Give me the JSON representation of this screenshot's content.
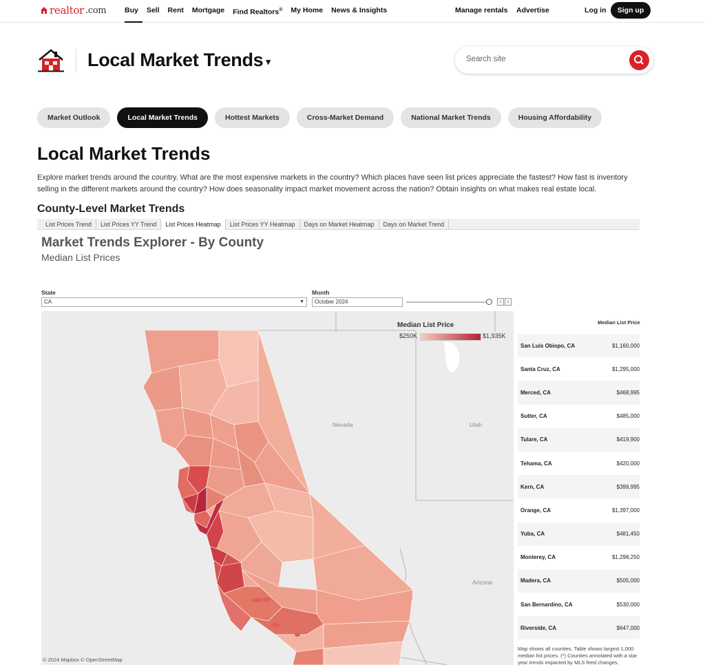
{
  "nav": {
    "logo": "realtor",
    "logo_suffix": ".com",
    "links": [
      "Buy",
      "Sell",
      "Rent",
      "Mortgage",
      "Find Realtors",
      "My Home",
      "News & Insights"
    ],
    "find_realtors_mark": "®",
    "manage_rentals": "Manage rentals",
    "advertise": "Advertise",
    "login": "Log in",
    "signup": "Sign up"
  },
  "header": {
    "title": "Local Market Trends",
    "caret": "▾",
    "search_placeholder": "Search site"
  },
  "pills": [
    "Market Outlook",
    "Local Market Trends",
    "Hottest Markets",
    "Cross-Market Demand",
    "National Market Trends",
    "Housing Affordability"
  ],
  "section": {
    "title": "Local Market Trends",
    "description": "Explore market trends around the country. What are the most expensive markets in the country? Which places have seen list prices appreciate the fastest? How fast is inventory selling in the different markets around the country? How does seasonality impact market movement across the nation? Obtain insights on what makes real estate local.",
    "subtitle": "County-Level Market Trends"
  },
  "viz": {
    "tabs": [
      "List Prices Trend",
      "List Prices YY Trend",
      "List Prices Heatmap",
      "List Prices YY Heatmap",
      "Days on Market Heatmap",
      "Days on Market Trend"
    ],
    "title": "Market Trends Explorer - By County",
    "subtitle": "Median List Prices",
    "state_label": "State",
    "state_value": "CA",
    "month_label": "Month",
    "month_value": "October 2024",
    "legend_title": "Median List Price",
    "legend_min": "$250K",
    "legend_max": "$1,935K",
    "legend_colors": [
      "#f6cdbf",
      "#b4213a"
    ],
    "state_names": [
      "Nevada",
      "Utah",
      "Arizona"
    ],
    "credit": "© 2024 Mapbox  © OpenStreetMap",
    "table_header": "Median List Price",
    "table_rows": [
      {
        "county": "San Luis Obispo, CA",
        "price": "$1,160,000"
      },
      {
        "county": "Santa Cruz, CA",
        "price": "$1,295,000"
      },
      {
        "county": "Merced, CA",
        "price": "$468,995"
      },
      {
        "county": "Sutter, CA",
        "price": "$485,000"
      },
      {
        "county": "Tulare, CA",
        "price": "$419,900"
      },
      {
        "county": "Tehama, CA",
        "price": "$420,000"
      },
      {
        "county": "Kern, CA",
        "price": "$399,995"
      },
      {
        "county": "Orange, CA",
        "price": "$1,397,000"
      },
      {
        "county": "Yuba, CA",
        "price": "$481,450"
      },
      {
        "county": "Monterey, CA",
        "price": "$1,298,250"
      },
      {
        "county": "Madera, CA",
        "price": "$505,000"
      },
      {
        "county": "San Bernardino, CA",
        "price": "$530,000"
      },
      {
        "county": "Riverside, CA",
        "price": "$647,000"
      }
    ],
    "table_note": "Map shows all counties. Table shows largest 1,000 median list prices. (*) Counties annotated with a star year trends impacted by MLS feed changes."
  }
}
